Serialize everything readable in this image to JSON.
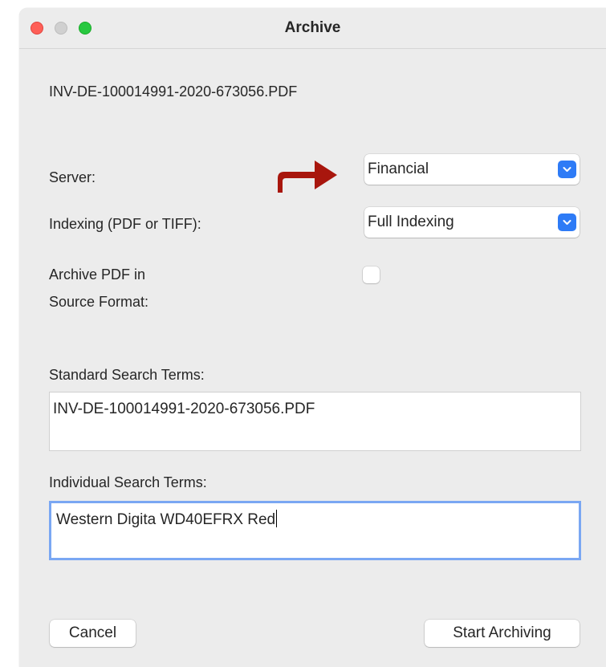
{
  "window": {
    "title": "Archive"
  },
  "file": {
    "name": "INV-DE-100014991-2020-673056.PDF"
  },
  "form": {
    "server_label": "Server:",
    "server_value": "Financial",
    "indexing_label": "Indexing (PDF or TIFF):",
    "indexing_value": "Full Indexing",
    "archive_pdf_label_line1": "Archive PDF in",
    "archive_pdf_label_line2": "Source Format:",
    "archive_pdf_checked": false
  },
  "standard_terms": {
    "label": "Standard Search Terms:",
    "value": "INV-DE-100014991-2020-673056.PDF"
  },
  "individual_terms": {
    "label": "Individual Search Terms:",
    "value": "Western Digita WD40EFRX Red"
  },
  "buttons": {
    "cancel": "Cancel",
    "start": "Start Archiving"
  },
  "colors": {
    "accent": "#2e7bf6",
    "annotation_arrow": "#a8160d",
    "window_bg": "#ececec"
  }
}
